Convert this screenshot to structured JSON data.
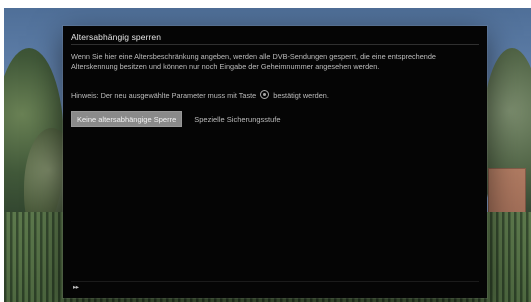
{
  "dialog": {
    "title": "Altersabhängig sperren",
    "description": "Wenn Sie hier eine Altersbeschränkung angeben, werden alle DVB-Sendungen gesperrt, die eine entsprechende Alterskennung besitzen und können nur noch Eingabe der Geheimnummer angesehen werden.",
    "hint_before": "Hinweis: Der neu ausgewählte Parameter muss mit Taste",
    "hint_key_icon": "ok-button-icon",
    "hint_after": "bestätigt werden.",
    "options": [
      {
        "label": "Keine altersabhängige Sperre",
        "selected": true
      },
      {
        "label": "Spezielle Sicherungsstufe",
        "selected": false
      }
    ],
    "footer_icon": "fast-forward-icon"
  },
  "colors": {
    "dialog_bg": "#050505",
    "selected_option_bg": "#8a8a8a",
    "text": "#bdbdbd"
  }
}
